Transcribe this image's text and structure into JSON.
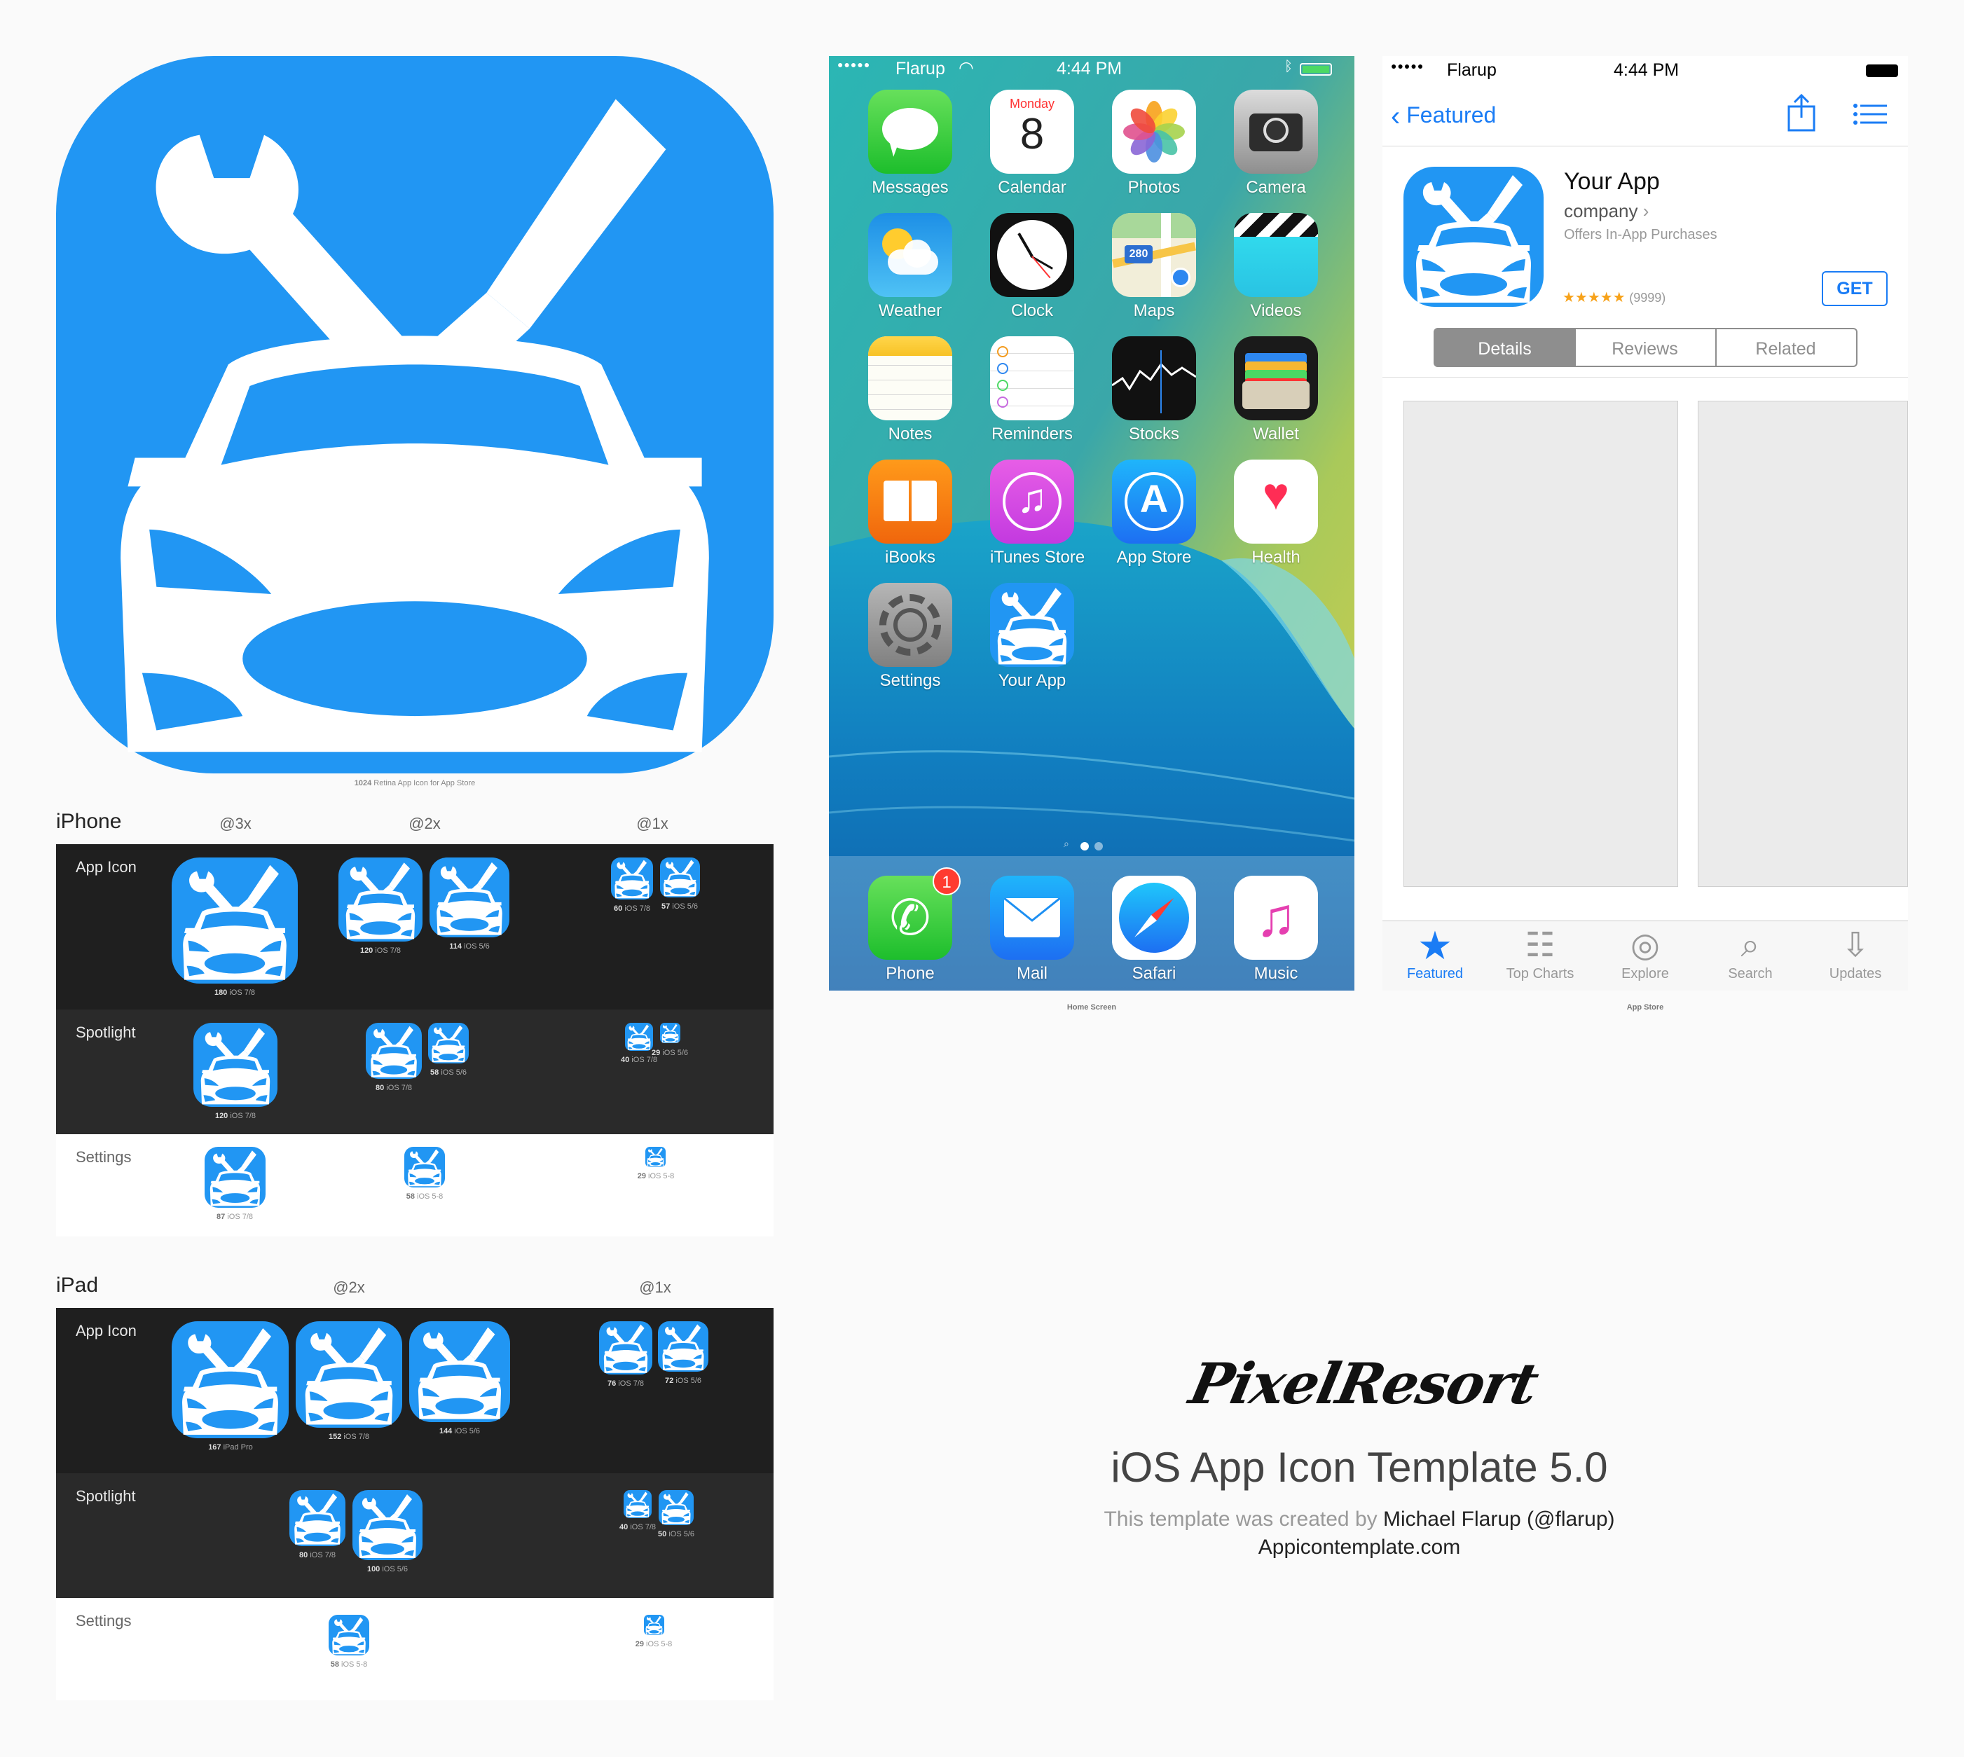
{
  "big_icon": {
    "caption_bold": "1024",
    "caption": "Retina App Icon for App Store"
  },
  "iphone": {
    "title": "iPhone",
    "cols": [
      "@3x",
      "@2x",
      "@1x"
    ],
    "rows": [
      {
        "label": "App Icon",
        "captions": [
          [
            "180",
            "iOS 7/8"
          ],
          [
            "120",
            "iOS 7/8"
          ],
          [
            "114",
            "iOS 5/6"
          ],
          [
            "60",
            "iOS 7/8"
          ],
          [
            "57",
            "iOS 5/6"
          ]
        ]
      },
      {
        "label": "Spotlight",
        "captions": [
          [
            "120",
            "iOS 7/8"
          ],
          [
            "80",
            "iOS 7/8"
          ],
          [
            "58",
            "iOS 5/6"
          ],
          [
            "40",
            "iOS 7/8"
          ],
          [
            "29",
            "iOS 5/6"
          ]
        ]
      },
      {
        "label": "Settings",
        "captions": [
          [
            "87",
            "iOS 7/8"
          ],
          [
            "58",
            "iOS 5-8"
          ],
          [
            "29",
            "iOS 5-8"
          ]
        ]
      }
    ]
  },
  "ipad": {
    "title": "iPad",
    "cols": [
      "@2x",
      "@1x"
    ],
    "rows": [
      {
        "label": "App Icon",
        "captions": [
          [
            "167",
            "iPad Pro"
          ],
          [
            "152",
            "iOS 7/8"
          ],
          [
            "144",
            "iOS 5/6"
          ],
          [
            "76",
            "iOS 7/8"
          ],
          [
            "72",
            "iOS 5/6"
          ]
        ]
      },
      {
        "label": "Spotlight",
        "captions": [
          [
            "80",
            "iOS 7/8"
          ],
          [
            "100",
            "iOS 5/6"
          ],
          [
            "40",
            "iOS 7/8"
          ],
          [
            "50",
            "iOS 5/6"
          ]
        ]
      },
      {
        "label": "Settings",
        "captions": [
          [
            "58",
            "iOS 5-8"
          ],
          [
            "29",
            "iOS 5-8"
          ]
        ]
      }
    ]
  },
  "home": {
    "caption": "Home Screen",
    "status": {
      "carrier": "Flarup",
      "time": "4:44 PM"
    },
    "calendar": {
      "day": "Monday",
      "date": "8"
    },
    "maps_shield": "280",
    "apps": [
      "Messages",
      "Calendar",
      "Photos",
      "Camera",
      "Weather",
      "Clock",
      "Maps",
      "Videos",
      "Notes",
      "Reminders",
      "Stocks",
      "Wallet",
      "iBooks",
      "iTunes Store",
      "App Store",
      "Health",
      "Settings",
      "Your App"
    ],
    "dock": [
      "Phone",
      "Mail",
      "Safari",
      "Music"
    ],
    "badge": "1"
  },
  "store": {
    "caption": "App Store",
    "status": {
      "carrier": "Flarup",
      "time": "4:44 PM"
    },
    "back": "Featured",
    "app_name": "Your App",
    "company": "company",
    "iap": "Offers In-App Purchases",
    "stars": "★★★★★",
    "reviews": "(9999)",
    "get": "GET",
    "segments": [
      "Details",
      "Reviews",
      "Related"
    ],
    "tabs": [
      "Featured",
      "Top Charts",
      "Explore",
      "Search",
      "Updates"
    ]
  },
  "credits": {
    "logo": "PixelResort",
    "title": "iOS App Icon Template 5.0",
    "line_prefix": "This template was created by ",
    "author": "Michael Flarup (@flarup)",
    "site": "Appicontemplate.com"
  },
  "colors": {
    "icon_blue": "#2196f3",
    "ios_blue": "#1a7cf5",
    "store_gray": "#8e8e8e"
  }
}
